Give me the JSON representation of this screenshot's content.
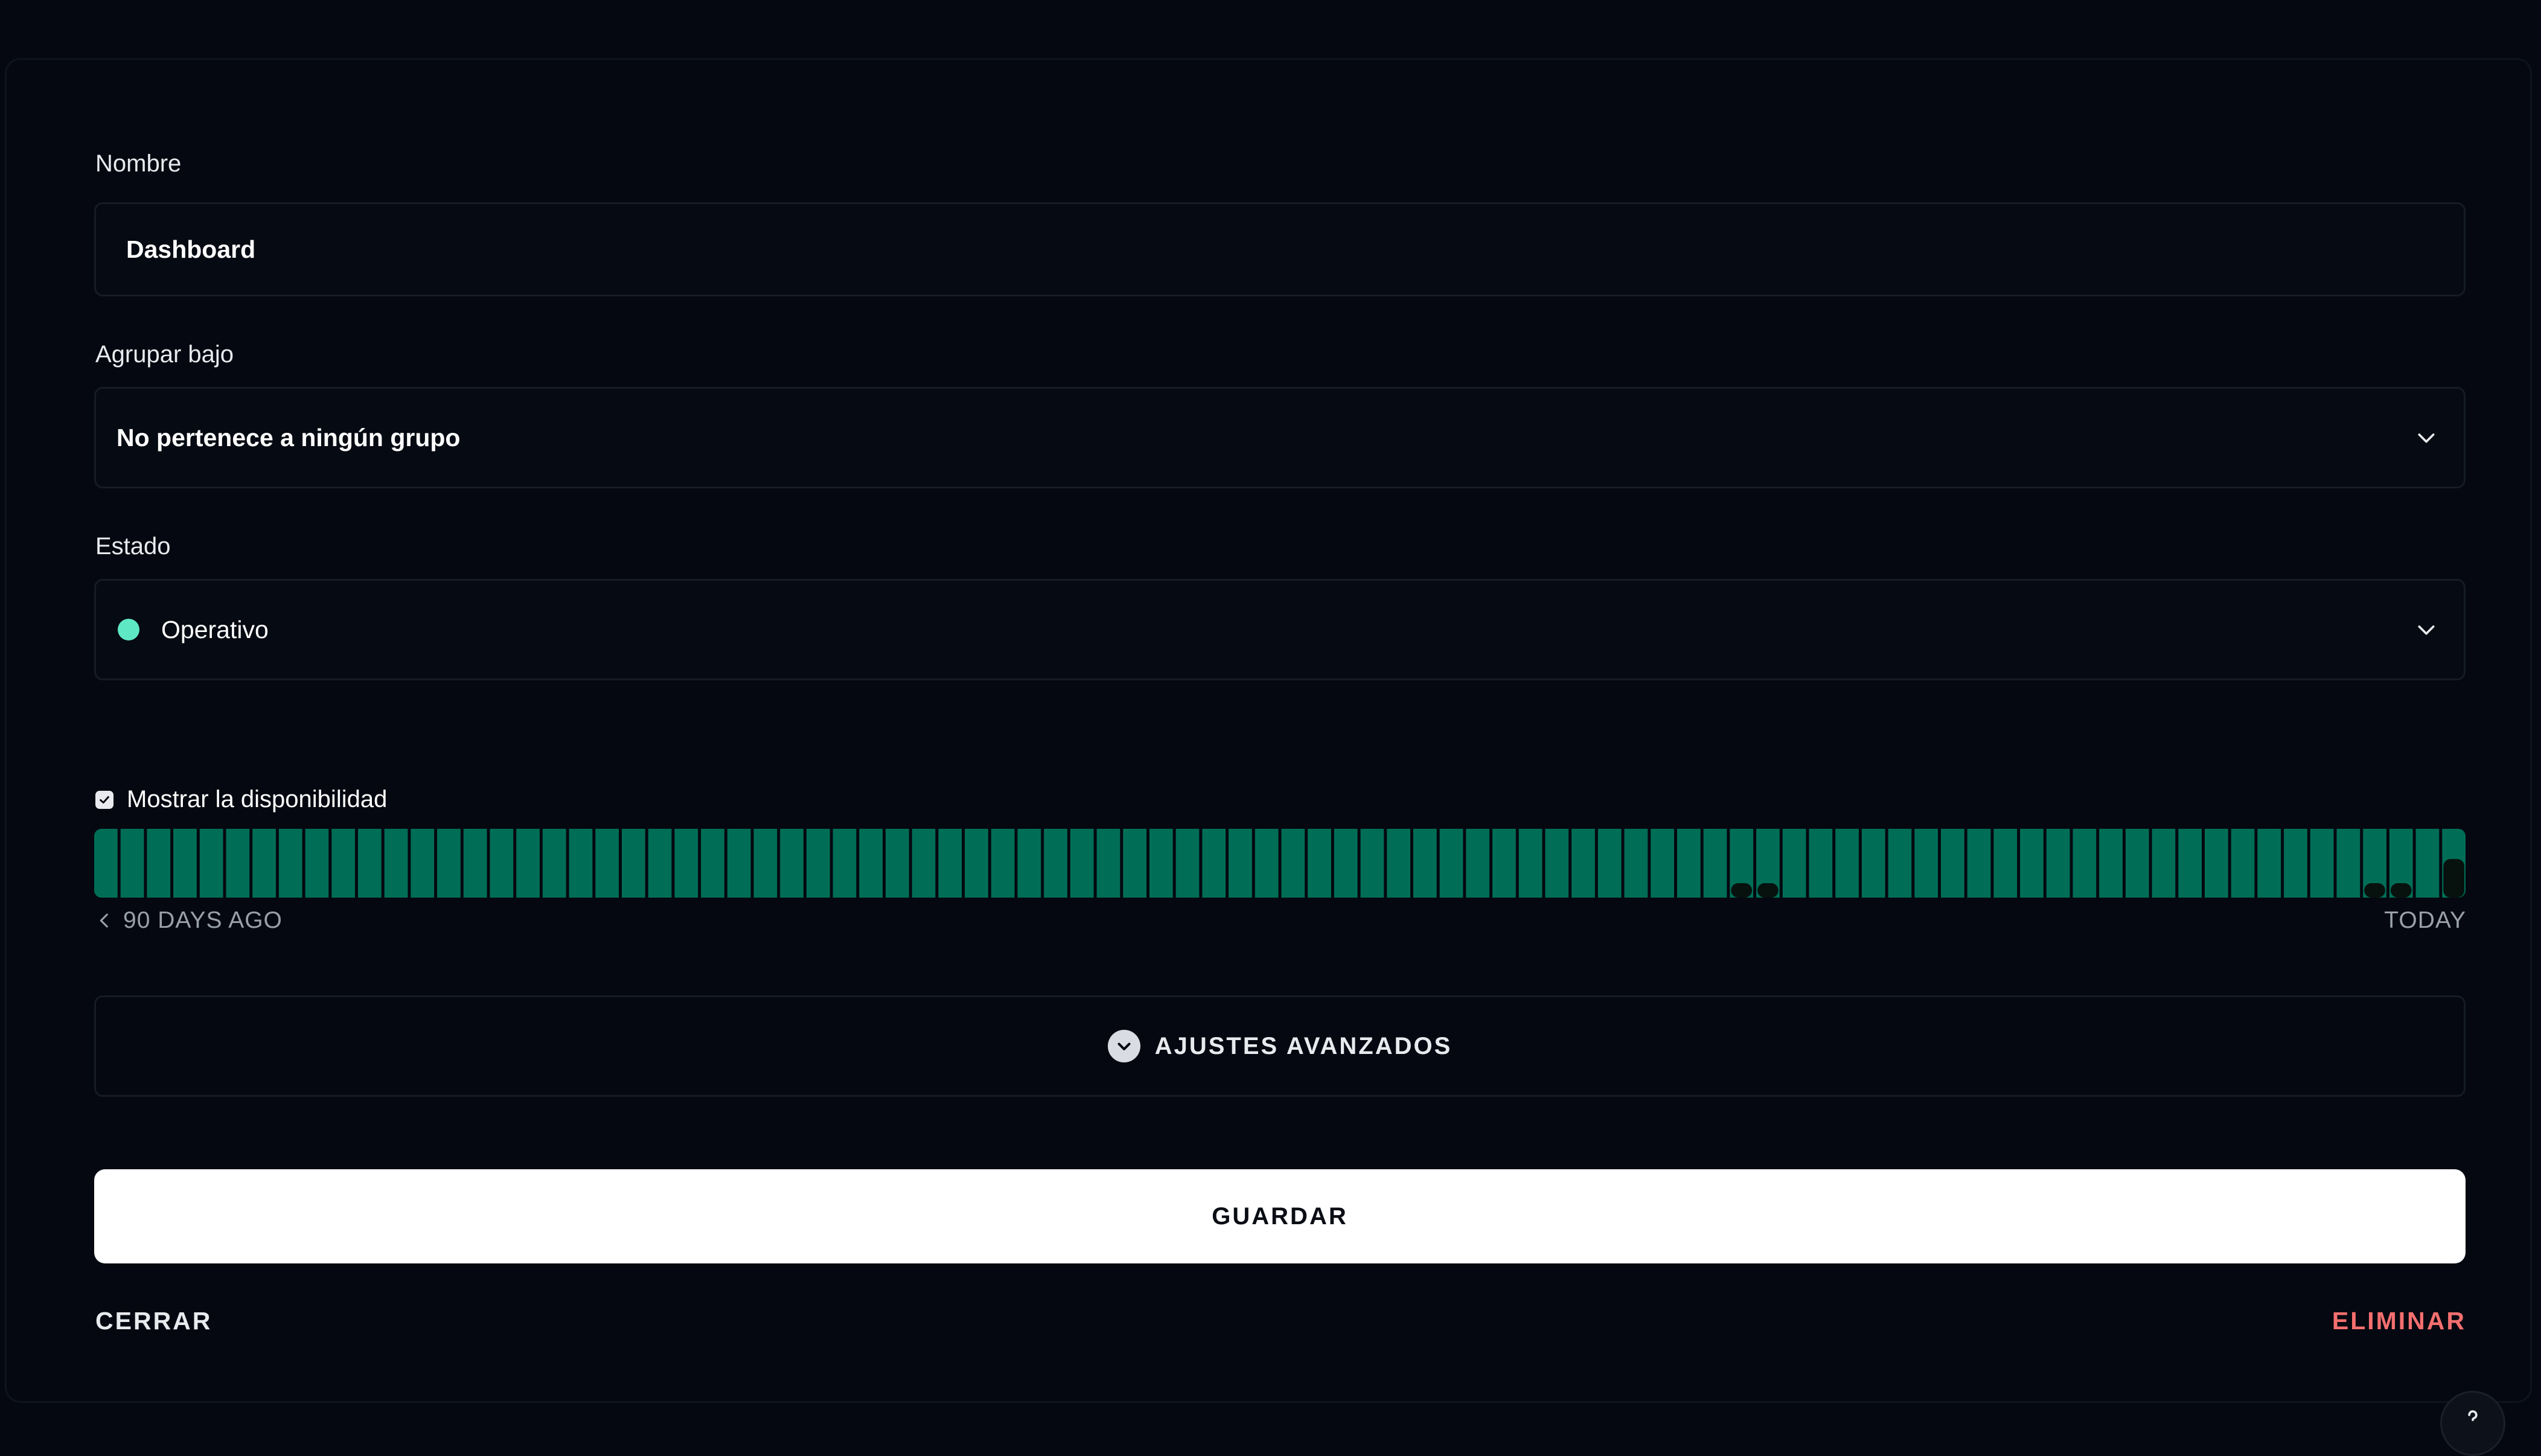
{
  "form": {
    "name_label": "Nombre",
    "name_value": "Dashboard",
    "group_label": "Agrupar bajo",
    "group_value": "No pertenece a ningún grupo",
    "status_label": "Estado",
    "status_value": "Operativo",
    "show_uptime_label": "Mostrar la disponibilidad",
    "show_uptime_checked": true
  },
  "uptime": {
    "range_start_label": "90 DAYS AGO",
    "range_end_label": "TODAY",
    "days": 90,
    "degraded_days": [
      63,
      64,
      87,
      88,
      90
    ]
  },
  "advanced": {
    "label": "AJUSTES AVANZADOS"
  },
  "actions": {
    "save_label": "GUARDAR",
    "close_label": "CERRAR",
    "delete_label": "ELIMINAR"
  },
  "colors": {
    "operational": "#5ee8c4",
    "uptime_bar": "#006e57",
    "danger": "#f46f6f"
  },
  "icons": {
    "chevron": "chevron-down-icon",
    "check": "check-icon",
    "help": "question-icon"
  }
}
